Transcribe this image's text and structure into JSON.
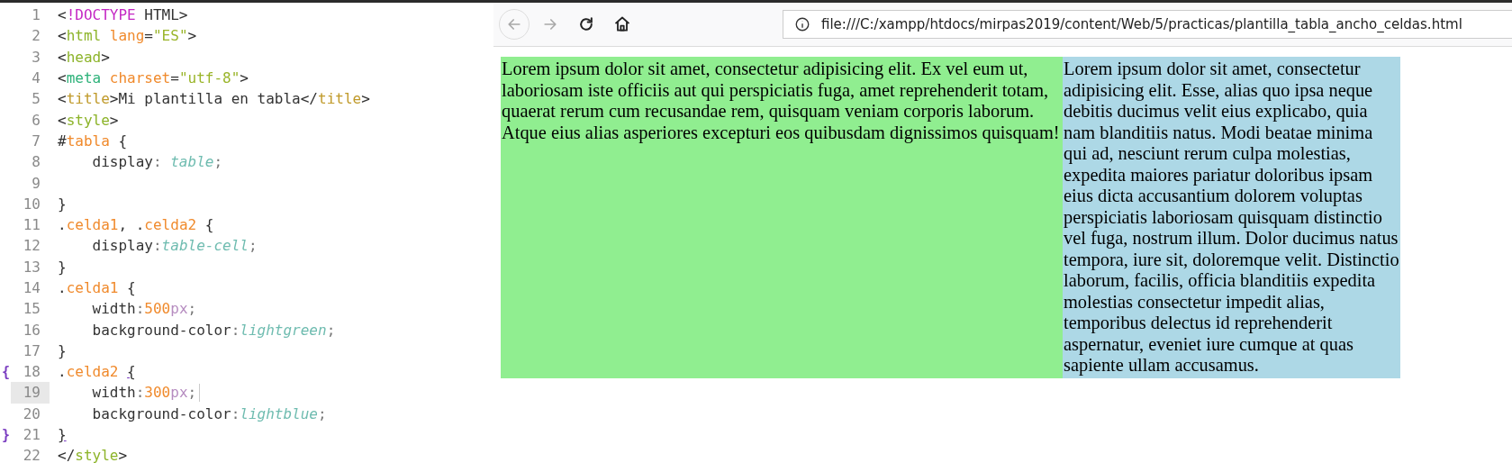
{
  "editor": {
    "lines": [
      {
        "number": "1",
        "current": false,
        "tokens": [
          {
            "text": "<",
            "kind": "plain"
          },
          {
            "text": "!DOCTYPE",
            "kind": "doctype"
          },
          {
            "text": " HTML>",
            "kind": "plain"
          }
        ]
      },
      {
        "number": "2",
        "current": false,
        "tokens": [
          {
            "text": "<",
            "kind": "plain"
          },
          {
            "text": "html",
            "kind": "tag"
          },
          {
            "text": " lang",
            "kind": "attr"
          },
          {
            "text": "=",
            "kind": "plain"
          },
          {
            "text": "\"ES\"",
            "kind": "string"
          },
          {
            "text": ">",
            "kind": "plain"
          }
        ]
      },
      {
        "number": "3",
        "current": false,
        "tokens": [
          {
            "text": "<",
            "kind": "plain"
          },
          {
            "text": "head",
            "kind": "tag"
          },
          {
            "text": ">",
            "kind": "plain"
          }
        ]
      },
      {
        "number": "4",
        "current": false,
        "tokens": [
          {
            "text": "<",
            "kind": "plain"
          },
          {
            "text": "meta",
            "kind": "tag_teal"
          },
          {
            "text": " charset",
            "kind": "attr"
          },
          {
            "text": "=",
            "kind": "plain"
          },
          {
            "text": "\"utf-8\"",
            "kind": "string"
          },
          {
            "text": ">",
            "kind": "plain"
          }
        ]
      },
      {
        "number": "5",
        "current": false,
        "tokens": [
          {
            "text": "<",
            "kind": "plain"
          },
          {
            "text": "title",
            "kind": "tag_gold"
          },
          {
            "text": ">Mi plantilla en tabla</",
            "kind": "plain"
          },
          {
            "text": "title",
            "kind": "tag_gold"
          },
          {
            "text": ">",
            "kind": "plain"
          }
        ]
      },
      {
        "number": "6",
        "current": false,
        "tokens": [
          {
            "text": "<",
            "kind": "plain"
          },
          {
            "text": "style",
            "kind": "tag"
          },
          {
            "text": ">",
            "kind": "plain"
          }
        ]
      },
      {
        "number": "7",
        "current": false,
        "tokens": [
          {
            "text": "#",
            "kind": "plain"
          },
          {
            "text": "tabla",
            "kind": "selector"
          },
          {
            "text": " {",
            "kind": "plain"
          }
        ]
      },
      {
        "number": "8",
        "current": false,
        "tokens": [
          {
            "text": "    display",
            "kind": "plain"
          },
          {
            "text": ": ",
            "kind": "punct"
          },
          {
            "text": "table",
            "kind": "value"
          },
          {
            "text": ";",
            "kind": "punct"
          }
        ]
      },
      {
        "number": "9",
        "current": false
      },
      {
        "number": "10",
        "current": false,
        "tokens": [
          {
            "text": "}",
            "kind": "plain"
          }
        ]
      },
      {
        "number": "11",
        "current": false,
        "tokens": [
          {
            "text": ".",
            "kind": "plain"
          },
          {
            "text": "celda1",
            "kind": "selector"
          },
          {
            "text": ", .",
            "kind": "plain"
          },
          {
            "text": "celda2",
            "kind": "selector"
          },
          {
            "text": " {",
            "kind": "plain"
          }
        ]
      },
      {
        "number": "12",
        "current": false,
        "tokens": [
          {
            "text": "    display",
            "kind": "plain"
          },
          {
            "text": ":",
            "kind": "punct"
          },
          {
            "text": "table-cell",
            "kind": "value"
          },
          {
            "text": ";",
            "kind": "punct"
          }
        ]
      },
      {
        "number": "13",
        "current": false,
        "tokens": [
          {
            "text": "}",
            "kind": "plain"
          }
        ]
      },
      {
        "number": "14",
        "current": false,
        "tokens": [
          {
            "text": ".",
            "kind": "plain"
          },
          {
            "text": "celda1",
            "kind": "selector"
          },
          {
            "text": " {",
            "kind": "plain"
          }
        ]
      },
      {
        "number": "15",
        "current": false,
        "tokens": [
          {
            "text": "    width",
            "kind": "plain"
          },
          {
            "text": ":",
            "kind": "punct"
          },
          {
            "text": "500",
            "kind": "number"
          },
          {
            "text": "px",
            "kind": "unit"
          },
          {
            "text": ";",
            "kind": "punct"
          }
        ]
      },
      {
        "number": "16",
        "current": false,
        "tokens": [
          {
            "text": "    background-color",
            "kind": "plain"
          },
          {
            "text": ":",
            "kind": "punct"
          },
          {
            "text": "lightgreen",
            "kind": "value"
          },
          {
            "text": ";",
            "kind": "punct"
          }
        ]
      },
      {
        "number": "17",
        "current": false,
        "tokens": [
          {
            "text": "}",
            "kind": "plain"
          }
        ]
      },
      {
        "number": "18",
        "current": false,
        "fold_marker": "{",
        "tokens": [
          {
            "text": ".",
            "kind": "plain"
          },
          {
            "text": "celda2 ",
            "kind": "selector"
          },
          {
            "text": "{",
            "kind": "bracket_match"
          }
        ]
      },
      {
        "number": "19",
        "current": true,
        "tokens": [
          {
            "text": "    width",
            "kind": "plain"
          },
          {
            "text": ":",
            "kind": "punct"
          },
          {
            "text": "300",
            "kind": "number"
          },
          {
            "text": "px",
            "kind": "unit"
          },
          {
            "text": ";",
            "kind": "punct"
          }
        ]
      },
      {
        "number": "20",
        "current": false,
        "tokens": [
          {
            "text": "    background-color",
            "kind": "plain"
          },
          {
            "text": ":",
            "kind": "punct"
          },
          {
            "text": "lightblue",
            "kind": "value"
          },
          {
            "text": ";",
            "kind": "punct"
          }
        ]
      },
      {
        "number": "21",
        "current": false,
        "fold_marker": "}",
        "tokens": [
          {
            "text": "}",
            "kind": "bracket_match"
          }
        ]
      },
      {
        "number": "22",
        "current": false,
        "tokens": [
          {
            "text": "</",
            "kind": "plain"
          },
          {
            "text": "style",
            "kind": "tag"
          },
          {
            "text": ">",
            "kind": "plain"
          }
        ]
      }
    ]
  },
  "browser": {
    "back": {
      "disabled": true
    },
    "forward": {
      "disabled": true
    },
    "url": "file:///C:/xampp/htdocs/mirpas2019/content/Web/5/practicas/plantilla_tabla_ancho_celdas.html",
    "cells": [
      {
        "text": "Lorem ipsum dolor sit amet, consectetur adipisicing elit. Ex vel eum ut, laboriosam iste officiis aut qui perspiciatis fuga, amet reprehenderit totam, quaerat rerum cum recusandae rem, quisquam veniam corporis laborum. Atque eius alias asperiores excepturi eos quibusdam dignissimos quisquam!",
        "color": "#90ee90"
      },
      {
        "text": "Lorem ipsum dolor sit amet, consectetur adipisicing elit. Esse, alias quo ipsa neque debitis ducimus velit eius explicabo, quia nam blanditiis natus. Modi beatae minima qui ad, nesciunt rerum culpa molestias, expedita maiores pariatur doloribus ipsam eius dicta accusantium dolorem voluptas perspiciatis laboriosam quisquam distinctio vel fuga, nostrum illum. Dolor ducimus natus tempora, iure sit, doloremque velit. Distinctio laborum, facilis, officia blanditiis expedita molestias consectetur impedit alias, temporibus delectus id reprehenderit aspernatur, eveniet iure cumque at quas sapiente ullam accusamus.",
        "color": "#add8e6"
      }
    ]
  }
}
